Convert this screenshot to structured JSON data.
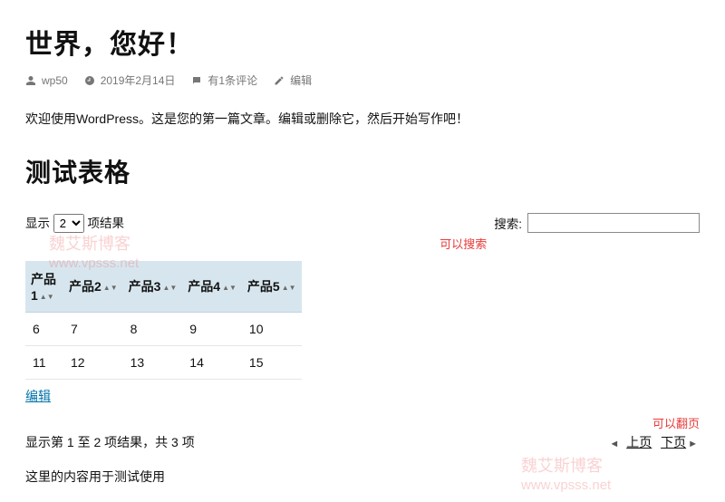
{
  "post": {
    "title": "世界，您好！",
    "author": "wp50",
    "date": "2019年2月14日",
    "comments": "有1条评论",
    "edit": "编辑",
    "intro": "欢迎使用WordPress。这是您的第一篇文章。编辑或删除它，然后开始写作吧！"
  },
  "section_title": "测试表格",
  "length": {
    "prefix": "显示",
    "value": "2",
    "options": [
      "2"
    ],
    "suffix": "项结果"
  },
  "search": {
    "label": "搜索:",
    "value": "",
    "annotation": "可以搜索"
  },
  "table": {
    "headers": [
      "产品1",
      "产品2",
      "产品3",
      "产品4",
      "产品5"
    ],
    "rows": [
      [
        "6",
        "7",
        "8",
        "9",
        "10"
      ],
      [
        "11",
        "12",
        "13",
        "14",
        "15"
      ]
    ]
  },
  "edit_link": "编辑",
  "info": "显示第 1 至 2 项结果，共 3 项",
  "pager": {
    "annotation": "可以翻页",
    "prev": "上页",
    "next": "下页"
  },
  "closing": "这里的内容用于测试使用",
  "watermark": {
    "line1": "魏艾斯博客",
    "line2": "www.vpsss.net"
  },
  "chart_data": {
    "type": "table",
    "headers": [
      "产品1",
      "产品2",
      "产品3",
      "产品4",
      "产品5"
    ],
    "rows": [
      [
        6,
        7,
        8,
        9,
        10
      ],
      [
        11,
        12,
        13,
        14,
        15
      ]
    ],
    "info": {
      "start": 1,
      "end": 2,
      "total": 3
    }
  }
}
